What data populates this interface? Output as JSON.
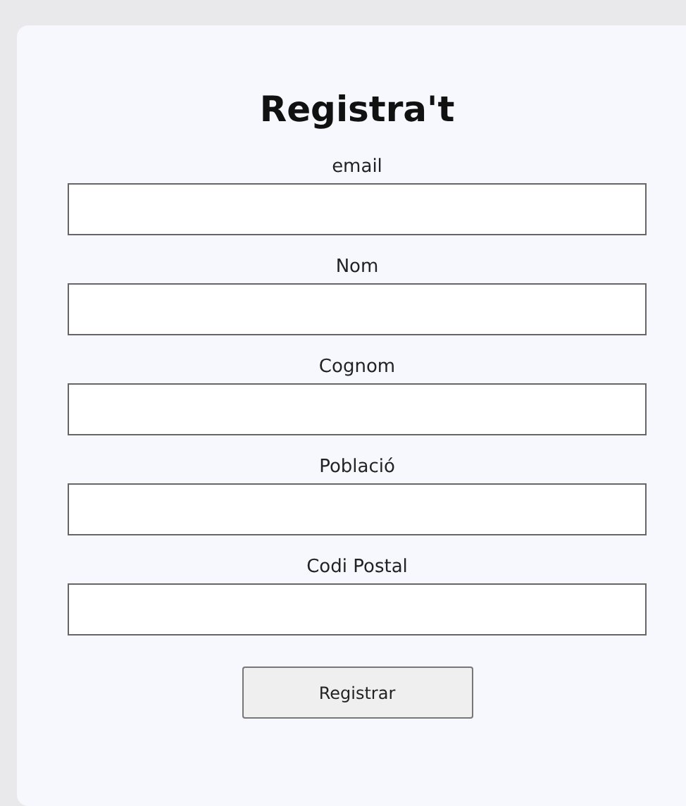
{
  "form": {
    "title": "Registra't",
    "fields": [
      {
        "label": "email"
      },
      {
        "label": "Nom"
      },
      {
        "label": "Cognom"
      },
      {
        "label": "Població"
      },
      {
        "label": "Codi Postal"
      }
    ],
    "submit": "Registrar"
  }
}
